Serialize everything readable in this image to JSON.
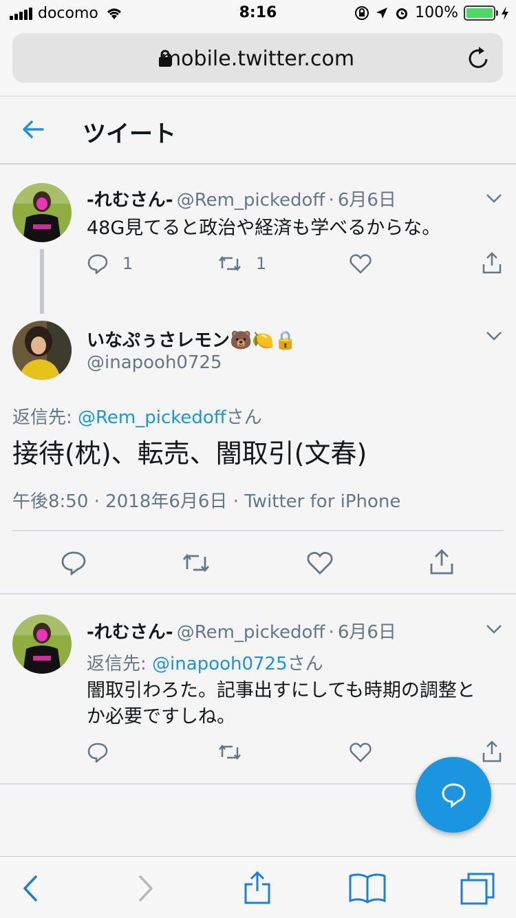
{
  "status_bar": {
    "carrier": "docomo",
    "time": "8:16",
    "battery": "100%",
    "battery_level": 1.0
  },
  "browser": {
    "url": "mobile.twitter.com"
  },
  "header": {
    "title": "ツイート"
  },
  "tweet1": {
    "name": "-れむさん-",
    "handle": "@Rem_pickedoff",
    "dot": "·",
    "date": "6月6日",
    "text": "48G見てると政治や経済も学べるからな。",
    "reply_count": "1",
    "retweet_count": "1"
  },
  "main_tweet": {
    "name": "いなぷぅさレモン🐻🍋🔒",
    "handle": "@inapooh0725",
    "reply_to_label": "返信先:",
    "reply_to_handle": "@Rem_pickedoff",
    "reply_to_suffix": "さん",
    "text": "接待(枕)、転売、闇取引(文春)",
    "meta": "午後8:50 · 2018年6月6日 · Twitter for iPhone"
  },
  "tweet3": {
    "name": "-れむさん-",
    "handle": "@Rem_pickedoff",
    "dot": "·",
    "date": "6月6日",
    "reply_to_label": "返信先:",
    "reply_to_handle": "@inapooh0725",
    "reply_to_suffix": "さん",
    "text_line1": "闇取引わろた。記事出すにしても時期の調整と",
    "text_line2": "か必要ですしね。"
  },
  "colors": {
    "accent": "#1b95e0",
    "text": "#14171a",
    "secondary": "#657786"
  }
}
